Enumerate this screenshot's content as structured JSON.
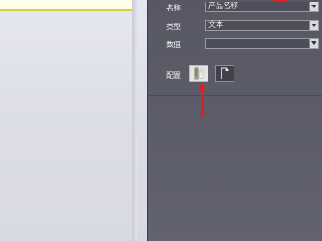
{
  "properties": {
    "name_label": "名称:",
    "name_value": "产品名称",
    "type_label": "类型:",
    "type_value": "文本",
    "data_label": "数值:",
    "data_value": "",
    "config_label": "配置:"
  },
  "icons": {
    "config_icon_1": "property-editor-icon",
    "config_icon_2": "field-picker-icon",
    "dropdown": "chevron-down-icon"
  },
  "colors": {
    "panel_bg": "#5a5b66",
    "highlight_arrow": "#e02020",
    "left_pane": "#e0e1ea",
    "selected_box_border": "#d8d23a"
  }
}
